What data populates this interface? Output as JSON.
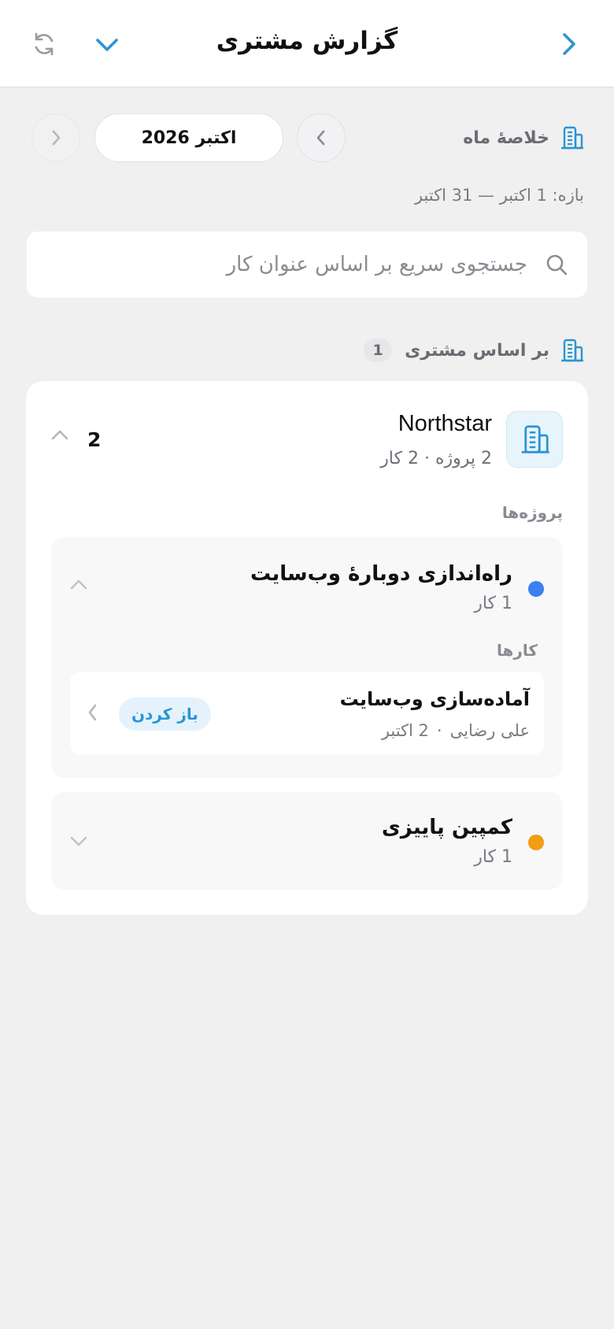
{
  "header": {
    "title": "گزارش مشتری",
    "icons": {
      "back": "chevron-right-icon",
      "dropdown": "chevron-down-icon",
      "refresh": "refresh-icon"
    }
  },
  "month": {
    "summary_label": "خلاصهٔ ماه",
    "current": "اکتبر 2026",
    "range": "بازه: 1 اکتبر — 31 اکتبر"
  },
  "search": {
    "placeholder": "جستجوی سریع بر اساس عنوان کار",
    "value": ""
  },
  "clients_section": {
    "label": "بر اساس مشتری",
    "count": "1"
  },
  "client": {
    "name": "Northstar",
    "meta": "2 پروژه · 2 کار",
    "count": "2",
    "projects_label": "پروژه‌ها",
    "projects": [
      {
        "title": "راه‌اندازی دوبارهٔ وب‌سایت",
        "meta": "1 کار",
        "tasks_label": "کارها",
        "task": {
          "title": "آماده‌سازی وب‌سایت",
          "assignee": "علی رضایی",
          "separator": "·",
          "date": "2 اکتبر",
          "badge": "باز کردن"
        }
      },
      {
        "title": "کمپین پاییزی",
        "meta": "1 کار"
      }
    ]
  },
  "colors": {
    "accent": "#2b95d2",
    "project_blue": "#3b7ff0",
    "project_orange": "#f29d12",
    "background": "#f0f0f1"
  }
}
